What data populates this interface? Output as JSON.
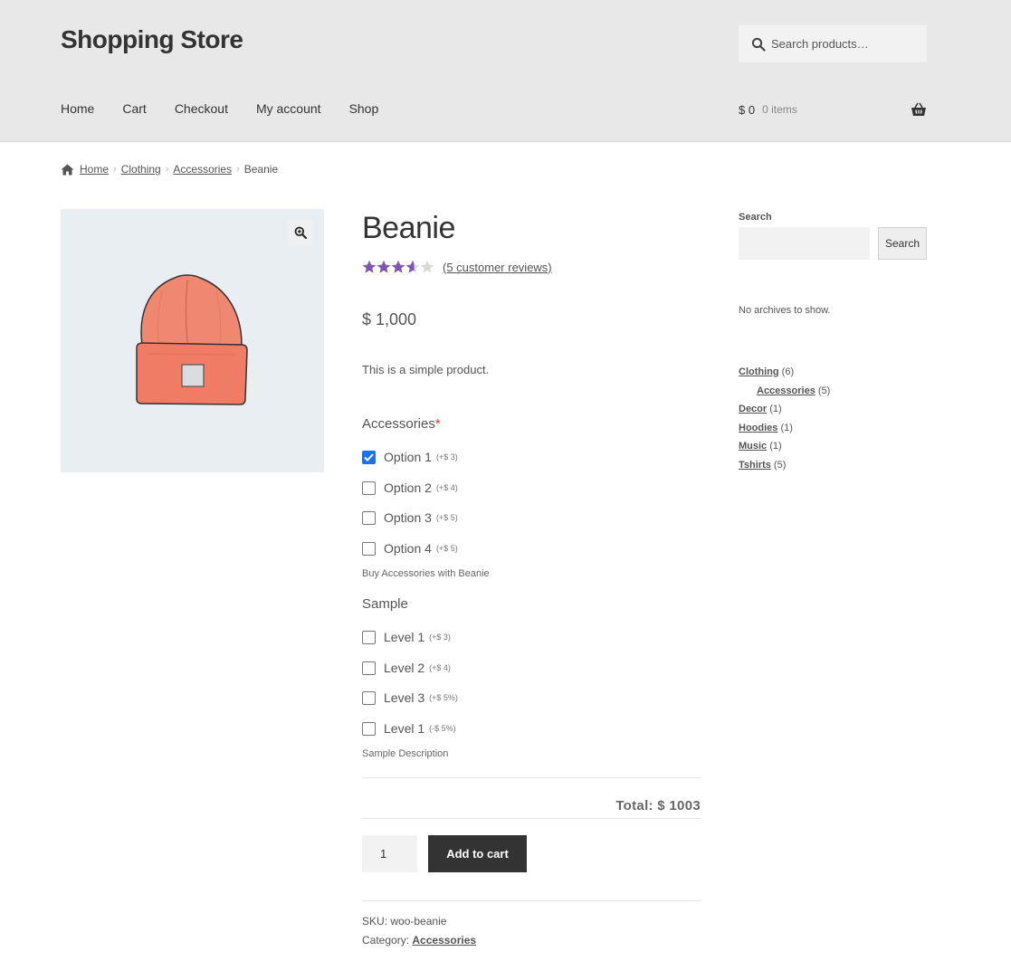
{
  "header": {
    "site_title": "Shopping Store",
    "search_placeholder": "Search products…",
    "nav": [
      "Home",
      "Cart",
      "Checkout",
      "My account",
      "Shop"
    ],
    "cart_total": "$ 0",
    "cart_items": "0 items"
  },
  "breadcrumb": {
    "items": [
      "Home",
      "Clothing",
      "Accessories"
    ],
    "current": "Beanie"
  },
  "product": {
    "title": "Beanie",
    "rating": 3.6,
    "rating_max": 5,
    "review_link": "(5 customer reviews)",
    "price": "$ 1,000",
    "short_description": "This is a simple product.",
    "accessories": {
      "label": "Accessories",
      "required_mark": "*",
      "options": [
        {
          "label": "Option 1",
          "delta": "(+$ 3)",
          "checked": true
        },
        {
          "label": "Option 2",
          "delta": "(+$ 4)",
          "checked": false
        },
        {
          "label": "Option 3",
          "delta": "(+$ 5)",
          "checked": false
        },
        {
          "label": "Option 4",
          "delta": "(+$ 5)",
          "checked": false
        }
      ],
      "description": "Buy Accessories with Beanie"
    },
    "sample": {
      "label": "Sample",
      "options": [
        {
          "label": "Level 1",
          "delta": "(+$ 3)",
          "checked": false
        },
        {
          "label": "Level 2",
          "delta": "(+$ 4)",
          "checked": false
        },
        {
          "label": "Level 3",
          "delta": "(+$ 5%)",
          "checked": false
        },
        {
          "label": "Level 1",
          "delta": "(-$ 5%)",
          "checked": false
        }
      ],
      "description": "Sample Description"
    },
    "total": "Total: $ 1003",
    "quantity": "1",
    "add_to_cart": "Add to cart",
    "sku_label": "SKU:",
    "sku": "woo-beanie",
    "category_label": "Category:",
    "category": "Accessories"
  },
  "sidebar": {
    "search_title": "Search",
    "search_button": "Search",
    "no_archives": "No archives to show.",
    "categories": [
      {
        "name": "Clothing",
        "count": "(6)",
        "sub": false
      },
      {
        "name": "Accessories",
        "count": "(5)",
        "sub": true
      },
      {
        "name": "Decor",
        "count": "(1)",
        "sub": false
      },
      {
        "name": "Hoodies",
        "count": "(1)",
        "sub": false
      },
      {
        "name": "Music",
        "count": "(1)",
        "sub": false
      },
      {
        "name": "Tshirts",
        "count": "(5)",
        "sub": false
      }
    ]
  },
  "colors": {
    "star_fill": "#7f54b3",
    "star_empty": "#d9d9d9",
    "checkbox_checked": "#1a73e8",
    "button_dark": "#333333",
    "required": "#e2401c"
  },
  "icons": {
    "search": "search-icon",
    "basket": "basket-icon",
    "home": "home-icon",
    "zoom": "zoom-in-icon",
    "star": "star-icon",
    "check": "check-icon"
  }
}
